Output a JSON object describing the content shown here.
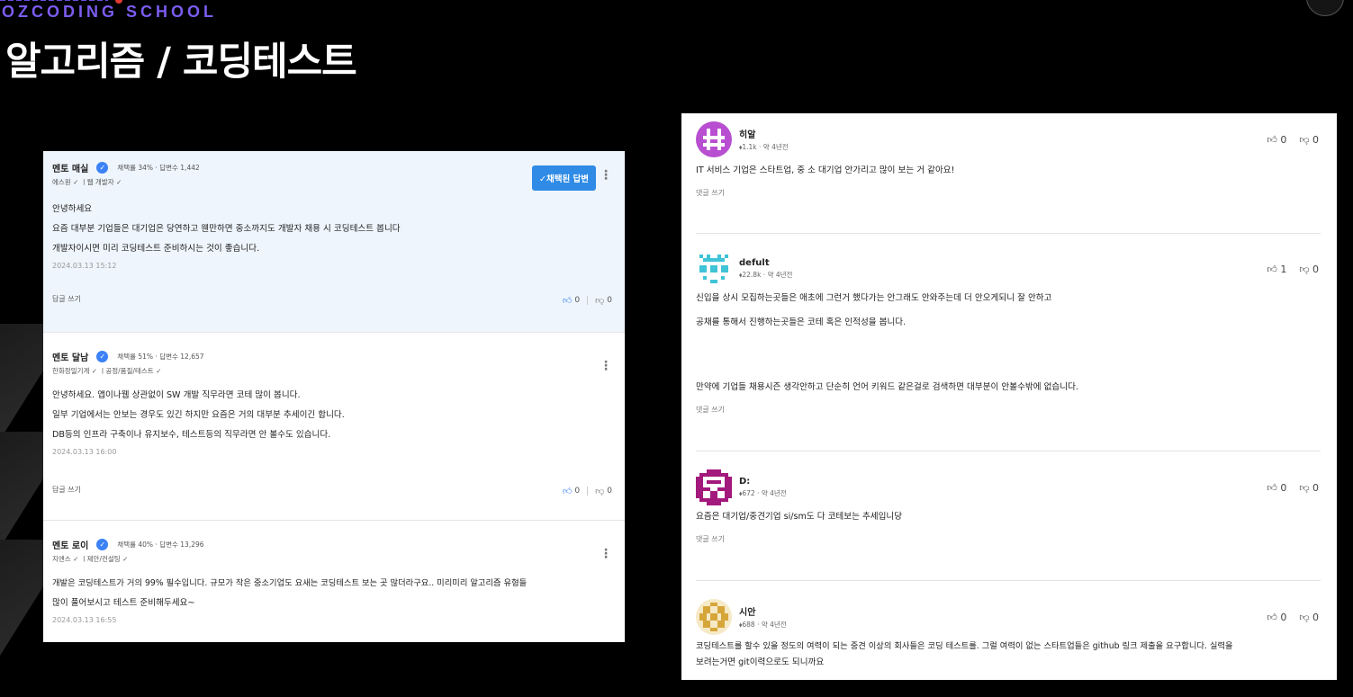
{
  "header": {
    "brand": "OZCODING SCHOOL",
    "title": "알고리즘 / 코딩테스트"
  },
  "colors": {
    "background": "#000000",
    "brand": "#7b5cf0",
    "accent_blue": "#2f8be6",
    "accepted_bg": "#eef5fc"
  },
  "left_panel": {
    "answers": [
      {
        "name": "멘토 매실",
        "stats": "채택률 34% · 답변수 1,442",
        "tags": "에스원 ✓ ㅣ웹 개발자 ✓",
        "accepted_label": "✓채택된 답변",
        "lines": [
          "안녕하세요",
          "요즘 대부분 기업들은 대기업은 당연하고 웬만하면 중소까지도 개발자 채용 시 코딩테스트 봅니다",
          "개발자이시면 미리 코딩테스트 준비하시는 것이 좋습니다."
        ],
        "date": "2024.03.13 15:12",
        "reply": "답글 쓰기",
        "likes": "0",
        "dislikes": "0"
      },
      {
        "name": "멘토 달남",
        "stats": "채택률 51% · 답변수 12,657",
        "tags": "한화정밀기계 ✓ ㅣ공정/품질/테스트 ✓",
        "lines": [
          "안녕하세요. 앱이나웹 상관없이 SW 개발 직무라면 코테 많이 봅니다.",
          "일부 기업에서는 안보는 경우도 있긴 하지만 요즘은 거의 대부분 추세이긴 합니다.",
          "DB등의 인프라 구축이나 유지보수, 테스트등의 직무라면 안 볼수도 있습니다."
        ],
        "date": "2024.03.13 16:00",
        "reply": "답글 쓰기",
        "likes": "0",
        "dislikes": "0"
      },
      {
        "name": "멘토 로이",
        "stats": "채택률 40% · 답변수 13,296",
        "tags": "지엔스 ✓ ㅣ제안/컨설팅 ✓",
        "lines": [
          "개발은 코딩테스트가 거의 99% 필수입니다. 규모가 작은 중소기업도 요새는 코딩테스트 보는 곳 많더라구요.. 미리미리 알고리즘 유형들",
          "많이 풀어보시고 테스트 준비해두세요~"
        ],
        "date": "2024.03.13 16:55"
      }
    ]
  },
  "right_panel": {
    "comments": [
      {
        "author": "히알",
        "meta": "⬧1.1k · 약 4년전",
        "likes": "0",
        "dislikes": "0",
        "text": [
          "IT 서비스 기업은 스타트업, 중 소 대기업 안가리고 많이 보는 거 같아요!"
        ],
        "reply": "댓글 쓰기",
        "avatar_color": "#b84fd1"
      },
      {
        "author": "defult",
        "meta": "⬧22.8k · 약 4년전",
        "likes": "1",
        "dislikes": "0",
        "text": [
          "신입을 상시 모집하는곳들은 애초에 그런거 했다가는 안그래도 안와주는데 더 안오게되니 잘 안하고",
          "공채를 통해서 진행하는곳들은 코테 혹은 인적성을 봅니다.",
          "만약에 기업들 채용시즌 생각안하고 단순히 언어 키워드 같은걸로 검색하면 대부분이 안볼수밖에 없습니다."
        ],
        "reply": "댓글 쓰기",
        "avatar_color": "#3fc3d6"
      },
      {
        "author": "D:",
        "meta": "⬧672 · 약 4년전",
        "likes": "0",
        "dislikes": "0",
        "text": [
          "요즘은 대기업/중견기업 si/sm도 다 코테보는 추세입니당"
        ],
        "reply": "댓글 쓰기",
        "avatar_color": "#a3197c"
      },
      {
        "author": "시안",
        "meta": "⬧688 · 약 4년전",
        "likes": "0",
        "dislikes": "0",
        "text": [
          "코딩테스트를 할수 있을 정도의 여력이 되는 중견 이상의 회사들은 코딩 테스트를. 그럴 여력이 없는 스타트업들은 github 링크 제출을 요구합니다.  실력을",
          "보려는거면 git이력으로도 되니까요"
        ],
        "avatar_color": "#d6a63a"
      }
    ]
  }
}
